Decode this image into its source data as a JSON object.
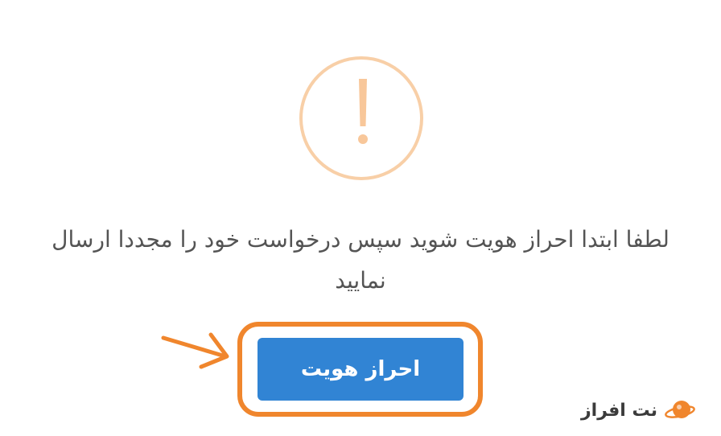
{
  "dialog": {
    "warning_icon": "exclamation-circle-icon",
    "message": "لطفا ابتدا احراز هویت شوید سپس درخواست خود را مجددا ارسال نمایید",
    "verify_button_label": "احراز هویت"
  },
  "annotation": {
    "arrow_icon": "arrow-right-icon",
    "highlight_color": "#f0862d"
  },
  "brand": {
    "name": "نت افراز",
    "logo_icon": "planet-logo-icon"
  },
  "colors": {
    "warning": "#f8cfa7",
    "button": "#3184d4",
    "button_text": "#ffffff",
    "message_text": "#545454",
    "accent": "#f0862d"
  }
}
